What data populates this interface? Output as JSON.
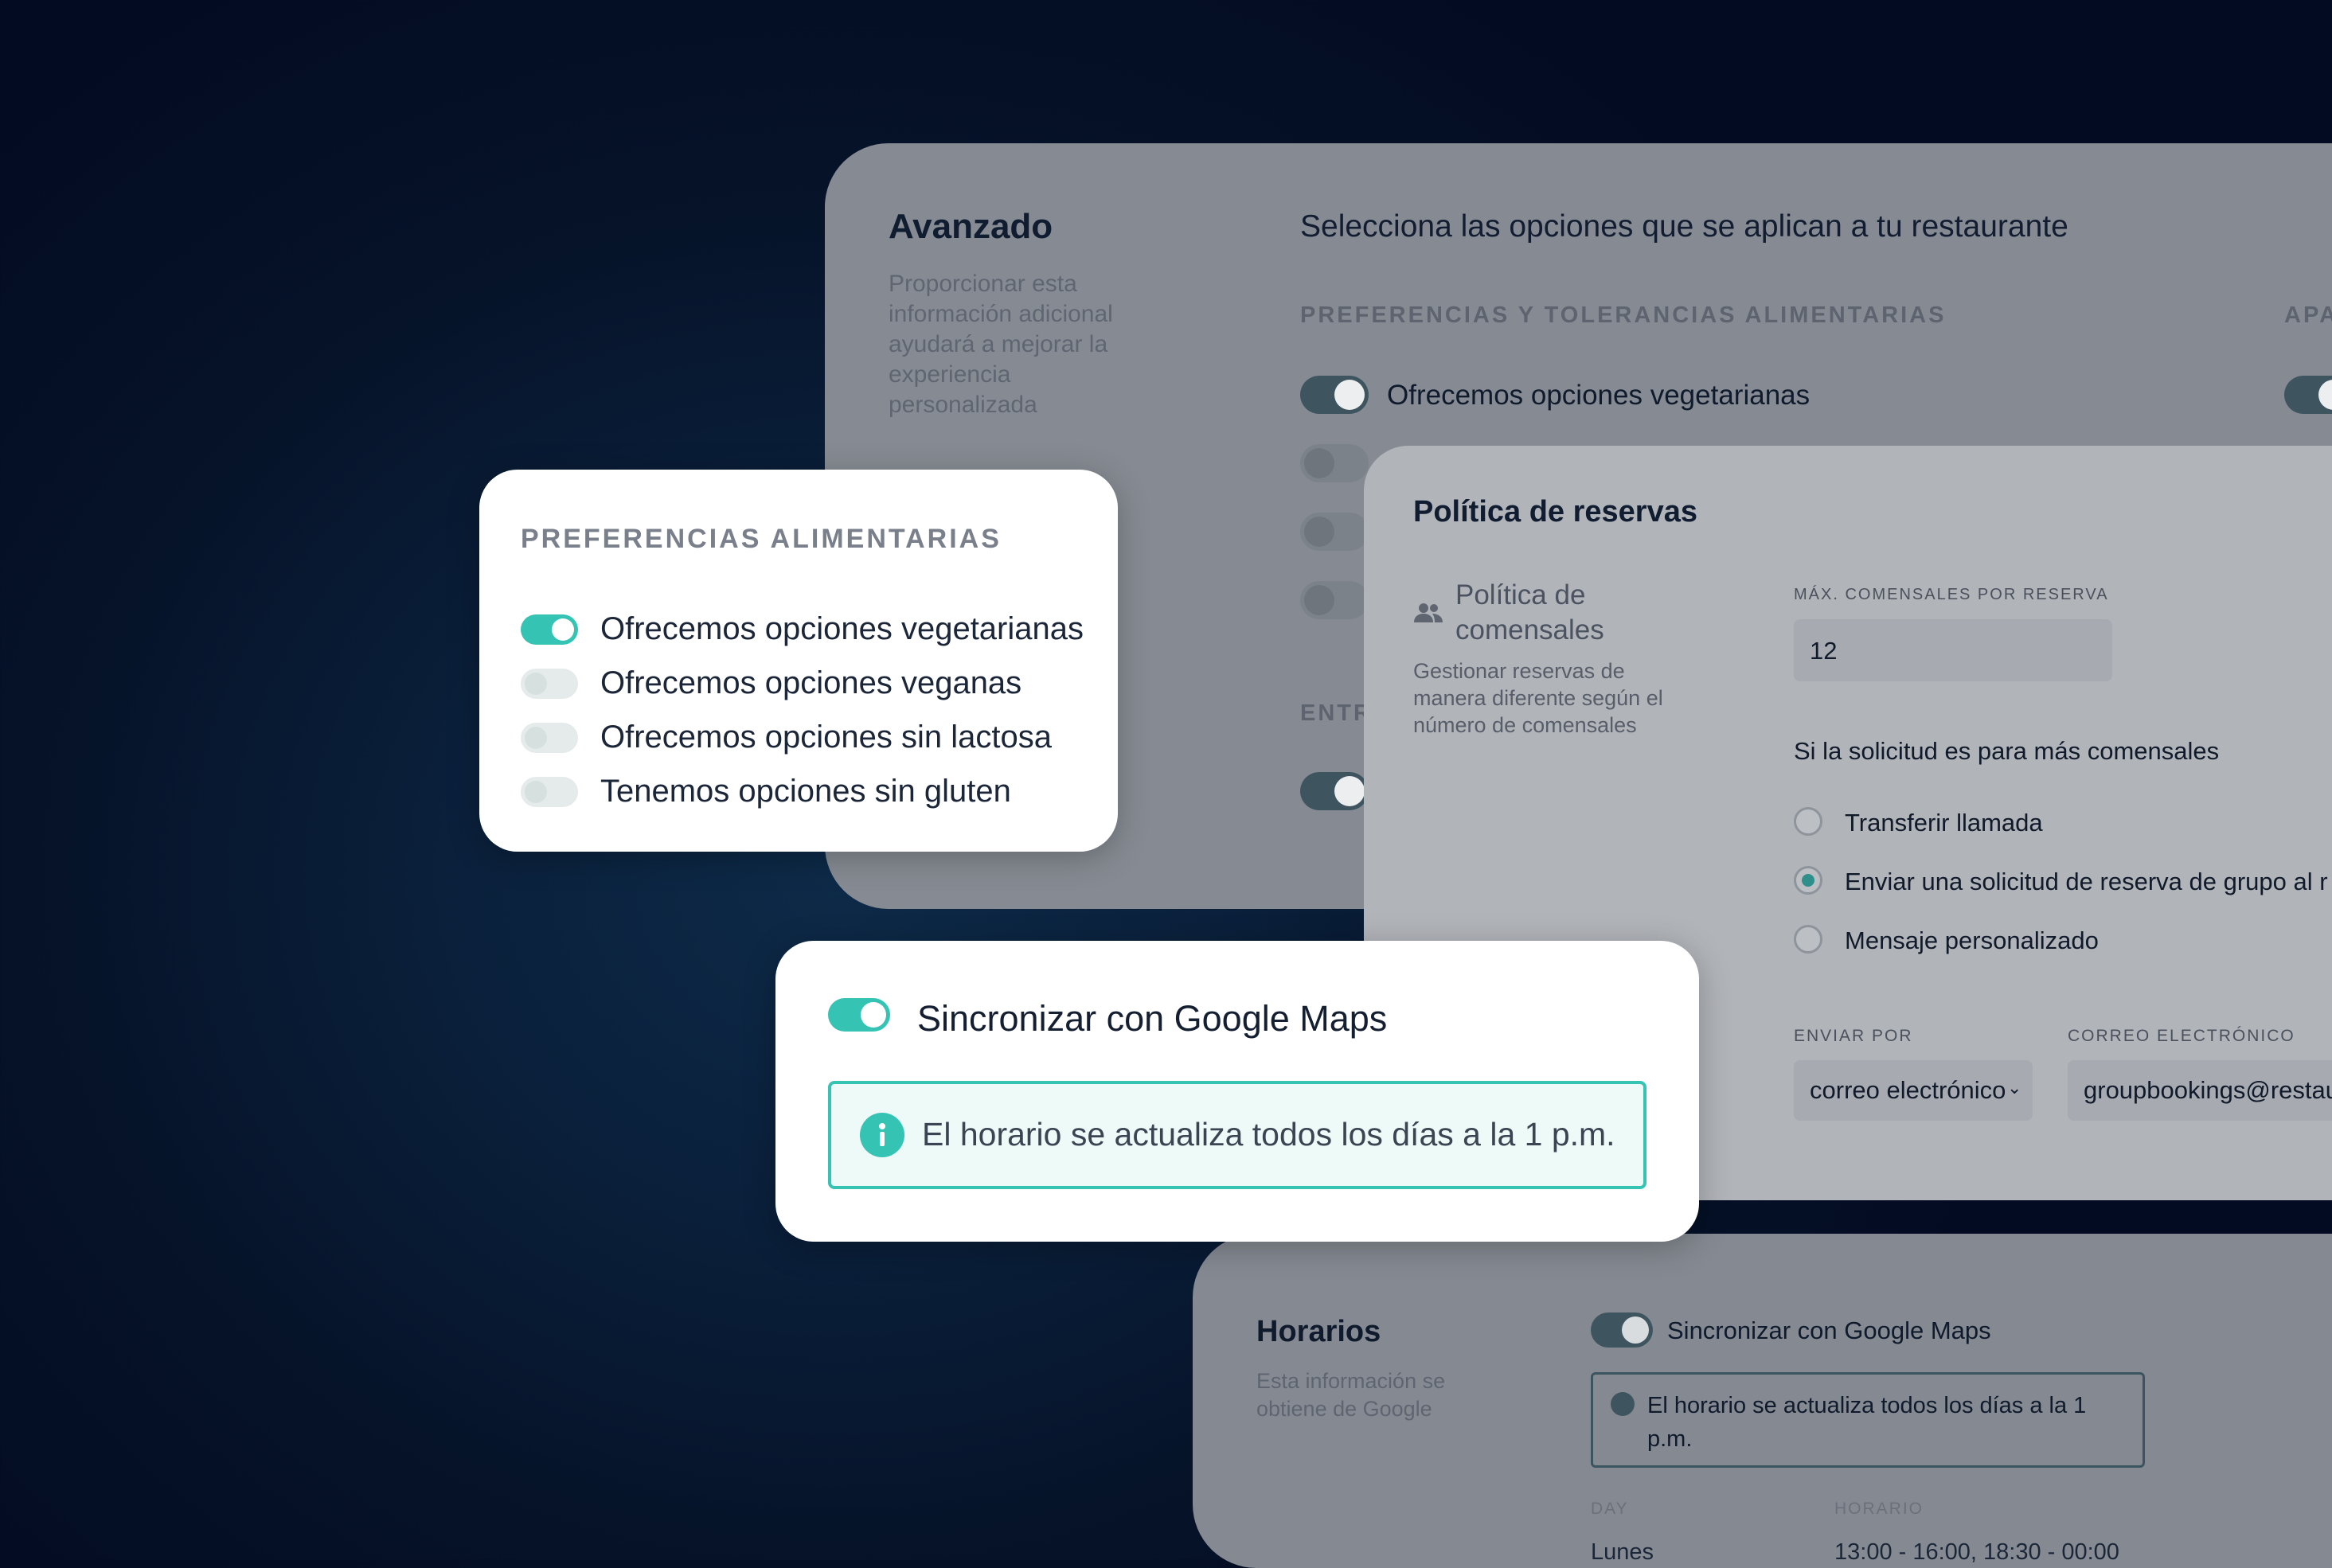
{
  "advanced": {
    "title": "Avanzado",
    "description": "Proporcionar esta información adicional ayudará a mejorar la experiencia personalizada",
    "prompt": "Selecciona las opciones que se aplican a tu restaurante",
    "section_dietary": "PREFERENCIAS Y TOLERANCIAS ALIMENTARIAS",
    "section_right": "APA",
    "section_entr": "ENTR",
    "vegetarian_label": "Ofrecemos opciones vegetarianas"
  },
  "booking_policy": {
    "title": "Política de reservas",
    "subsection_title": "Política de comensales",
    "subsection_desc": "Gestionar reservas de manera diferente según el número de comensales",
    "max_label": "MÁX. COMENSALES POR RESERVA",
    "max_value": "12",
    "if_more_label": "Si la solicitud es para más comensales",
    "options": [
      "Transferir llamada",
      "Enviar una solicitud de reserva de grupo al r",
      "Mensaje personalizado"
    ],
    "selected_option": "Enviar una solicitud de reserva de grupo al r",
    "send_by_label": "ENVIAR POR",
    "send_by_value": "correo electrónico",
    "email_label": "CORREO ELECTRÓNICO",
    "email_value": "groupbookings@restau"
  },
  "hours": {
    "title": "Horarios",
    "description": "Esta información se obtiene de Google",
    "sync_label": "Sincronizar con Google Maps",
    "info_text": "El horario se actualiza todos los días a la 1 p.m.",
    "col_day": "DAY",
    "col_hours": "HORARIO",
    "row_day": "Lunes",
    "row_hours": "13:00 - 16:00, 18:30 - 00:00"
  },
  "pref_card": {
    "title": "PREFERENCIAS ALIMENTARIAS",
    "items": [
      {
        "label": "Ofrecemos opciones vegetarianas",
        "on": true
      },
      {
        "label": "Ofrecemos opciones veganas",
        "on": false
      },
      {
        "label": "Ofrecemos opciones sin lactosa",
        "on": false
      },
      {
        "label": "Tenemos opciones sin gluten",
        "on": false
      }
    ]
  },
  "sync_card": {
    "label": "Sincronizar con Google Maps",
    "enabled": true,
    "info_text": "El horario se actualiza todos los días a la 1 p.m."
  },
  "colors": {
    "accent": "#35c4b4",
    "toggle_dim": "#3e5560",
    "info_bg": "#eefaf8"
  },
  "icons": [
    "people-icon",
    "info-icon"
  ]
}
